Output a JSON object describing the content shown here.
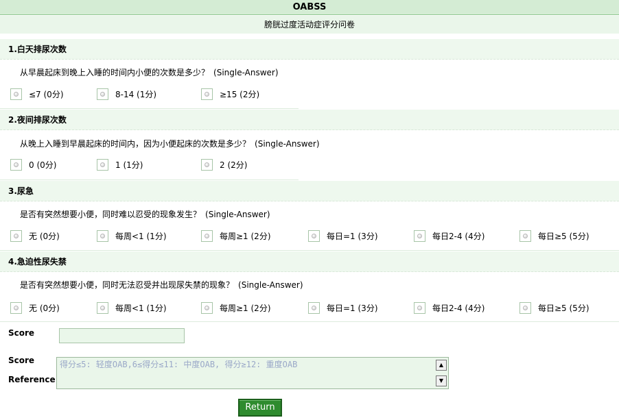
{
  "header": {
    "title": "OABSS",
    "subtitle": "膀胱过度活动症评分问卷"
  },
  "questions": [
    {
      "title": "1.白天排尿次数",
      "prompt": "从早晨起床到晚上入睡的时间内小便的次数是多少？",
      "type": "(Single-Answer)",
      "options": [
        "≤7 (0分)",
        "8-14 (1分)",
        "≥15 (2分)"
      ]
    },
    {
      "title": "2.夜间排尿次数",
      "prompt": "从晚上入睡到早晨起床的时间内，因为小便起床的次数是多少？",
      "type": "(Single-Answer)",
      "options": [
        "0 (0分)",
        "1 (1分)",
        "2 (2分)"
      ]
    },
    {
      "title": "3.尿急",
      "prompt": "是否有突然想要小便，同时难以忍受的现象发生？",
      "type": "(Single-Answer)",
      "options": [
        "无 (0分)",
        "每周<1 (1分)",
        "每周≥1 (2分)",
        "每日=1 (3分)",
        "每日2-4 (4分)",
        "每日≥5 (5分)"
      ]
    },
    {
      "title": "4.急迫性尿失禁",
      "prompt": "是否有突然想要小便，同时无法忍受并出现尿失禁的现象？",
      "type": "(Single-Answer)",
      "options": [
        "无 (0分)",
        "每周<1 (1分)",
        "每周≥1 (2分)",
        "每日=1 (3分)",
        "每日2-4 (4分)",
        "每日≥5 (5分)"
      ]
    }
  ],
  "score": {
    "label": "Score",
    "value": ""
  },
  "reference": {
    "label_line1": "Score",
    "label_line2": "Reference",
    "text": "得分≤5: 轻度OAB,6≤得分≤11: 中度OAB, 得分≥12: 重度OAB"
  },
  "icons": {
    "scroll_up": "scroll-up-arrow-icon",
    "scroll_down": "scroll-down-arrow-icon"
  },
  "actions": {
    "return_label": "Return"
  },
  "colors": {
    "header_bg": "#d4ecd4",
    "button_bg": "#2e8b2e"
  }
}
